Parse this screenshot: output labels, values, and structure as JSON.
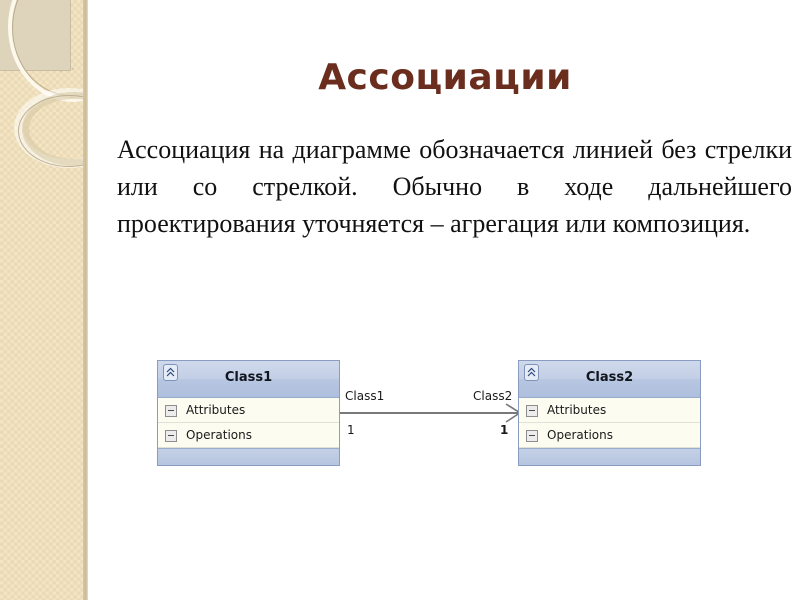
{
  "slide": {
    "title": "Ассоциации",
    "title_color": "#6b2d1d",
    "background": "#ffffff",
    "body_paragraph": "Ассоциация на диаграмме обозначается линией без стрелки или со стрелкой. Обычно в ходе дальнейшего проектирования уточняется – агрегация или композиция."
  },
  "sidebar": {
    "background_color": "#f2e4c4",
    "accent_block_color": "#ded3bb",
    "edge_color": "#c9bb96"
  },
  "diagram": {
    "type": "uml-class-diagram",
    "classes": [
      {
        "name": "Class1",
        "collapse_icon": "double-chevron-up-icon",
        "compartments": [
          {
            "label": "Attributes",
            "toggle_icon": "minus-box-icon"
          },
          {
            "label": "Operations",
            "toggle_icon": "minus-box-icon"
          }
        ]
      },
      {
        "name": "Class2",
        "collapse_icon": "double-chevron-up-icon",
        "compartments": [
          {
            "label": "Attributes",
            "toggle_icon": "minus-box-icon"
          },
          {
            "label": "Operations",
            "toggle_icon": "minus-box-icon"
          }
        ]
      }
    ],
    "association": {
      "source_role": "Class1",
      "target_role": "Class2",
      "source_multiplicity": "1",
      "target_multiplicity": "1",
      "arrow_style": "open-arrow",
      "line_color": "#77797b"
    },
    "header_gradient_top": "#cfd9ec",
    "header_gradient_bottom": "#aebfdd",
    "border_color": "#8a9dc0",
    "row_background": "#fcfcf1"
  }
}
